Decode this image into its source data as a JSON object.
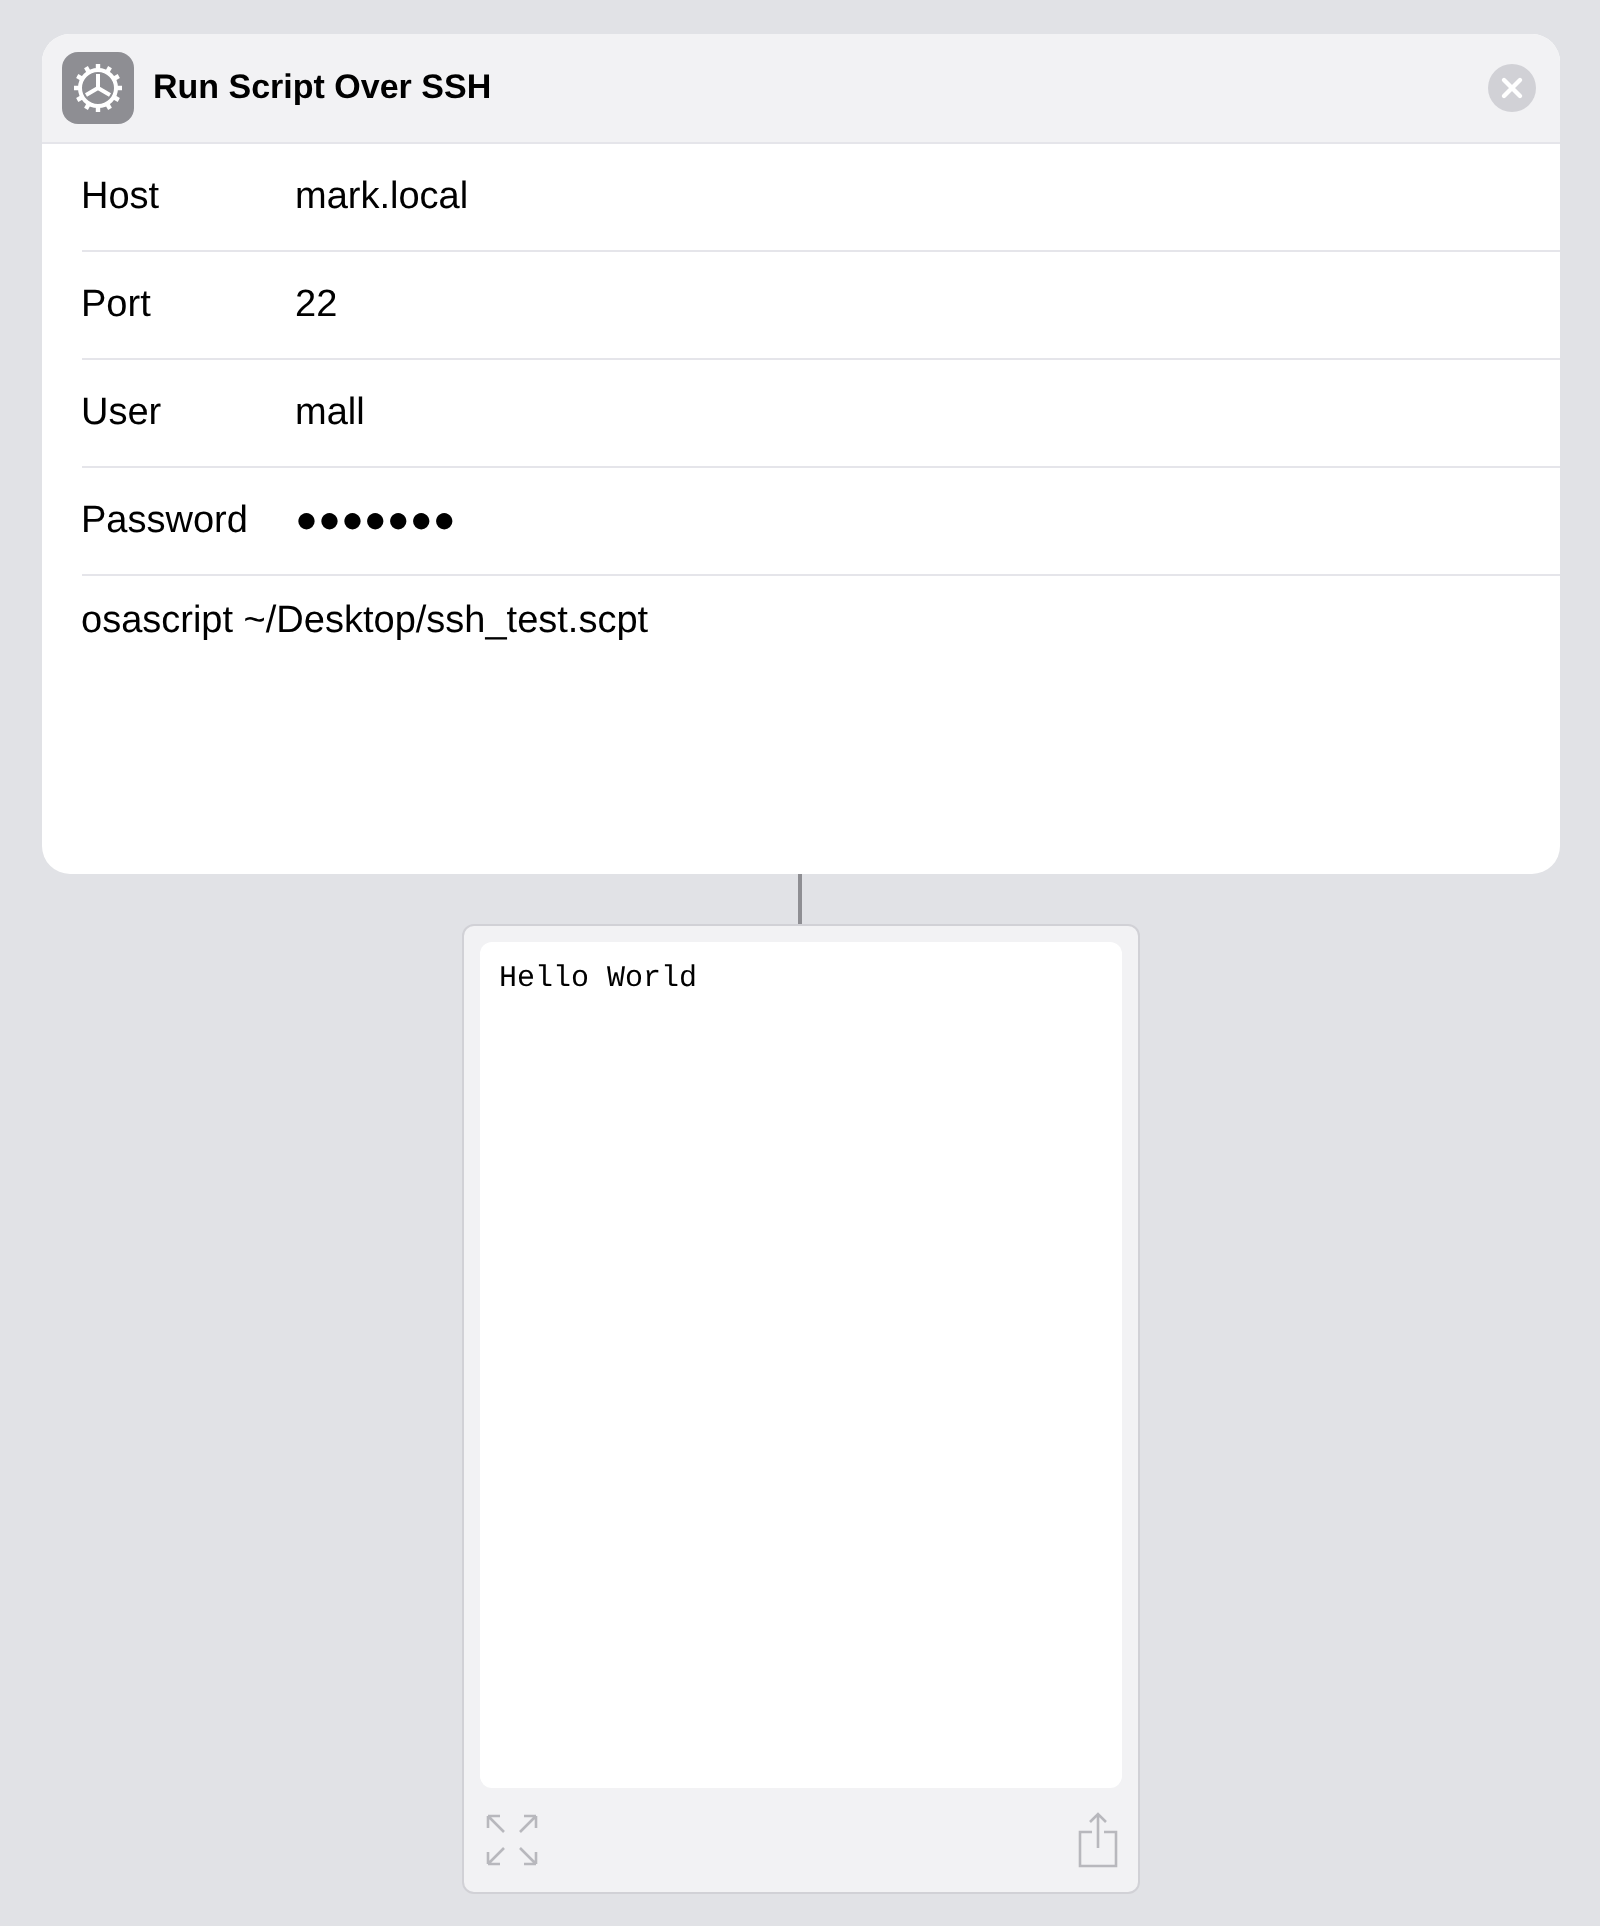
{
  "action": {
    "title": "Run Script Over SSH",
    "fields": [
      {
        "label": "Host",
        "value": "mark.local"
      },
      {
        "label": "Port",
        "value": "22"
      },
      {
        "label": "User",
        "value": "mall"
      },
      {
        "label": "Password",
        "value": "●●●●●●●"
      }
    ],
    "script": "osascript ~/Desktop/ssh_test.scpt"
  },
  "output": {
    "text": "Hello World"
  }
}
